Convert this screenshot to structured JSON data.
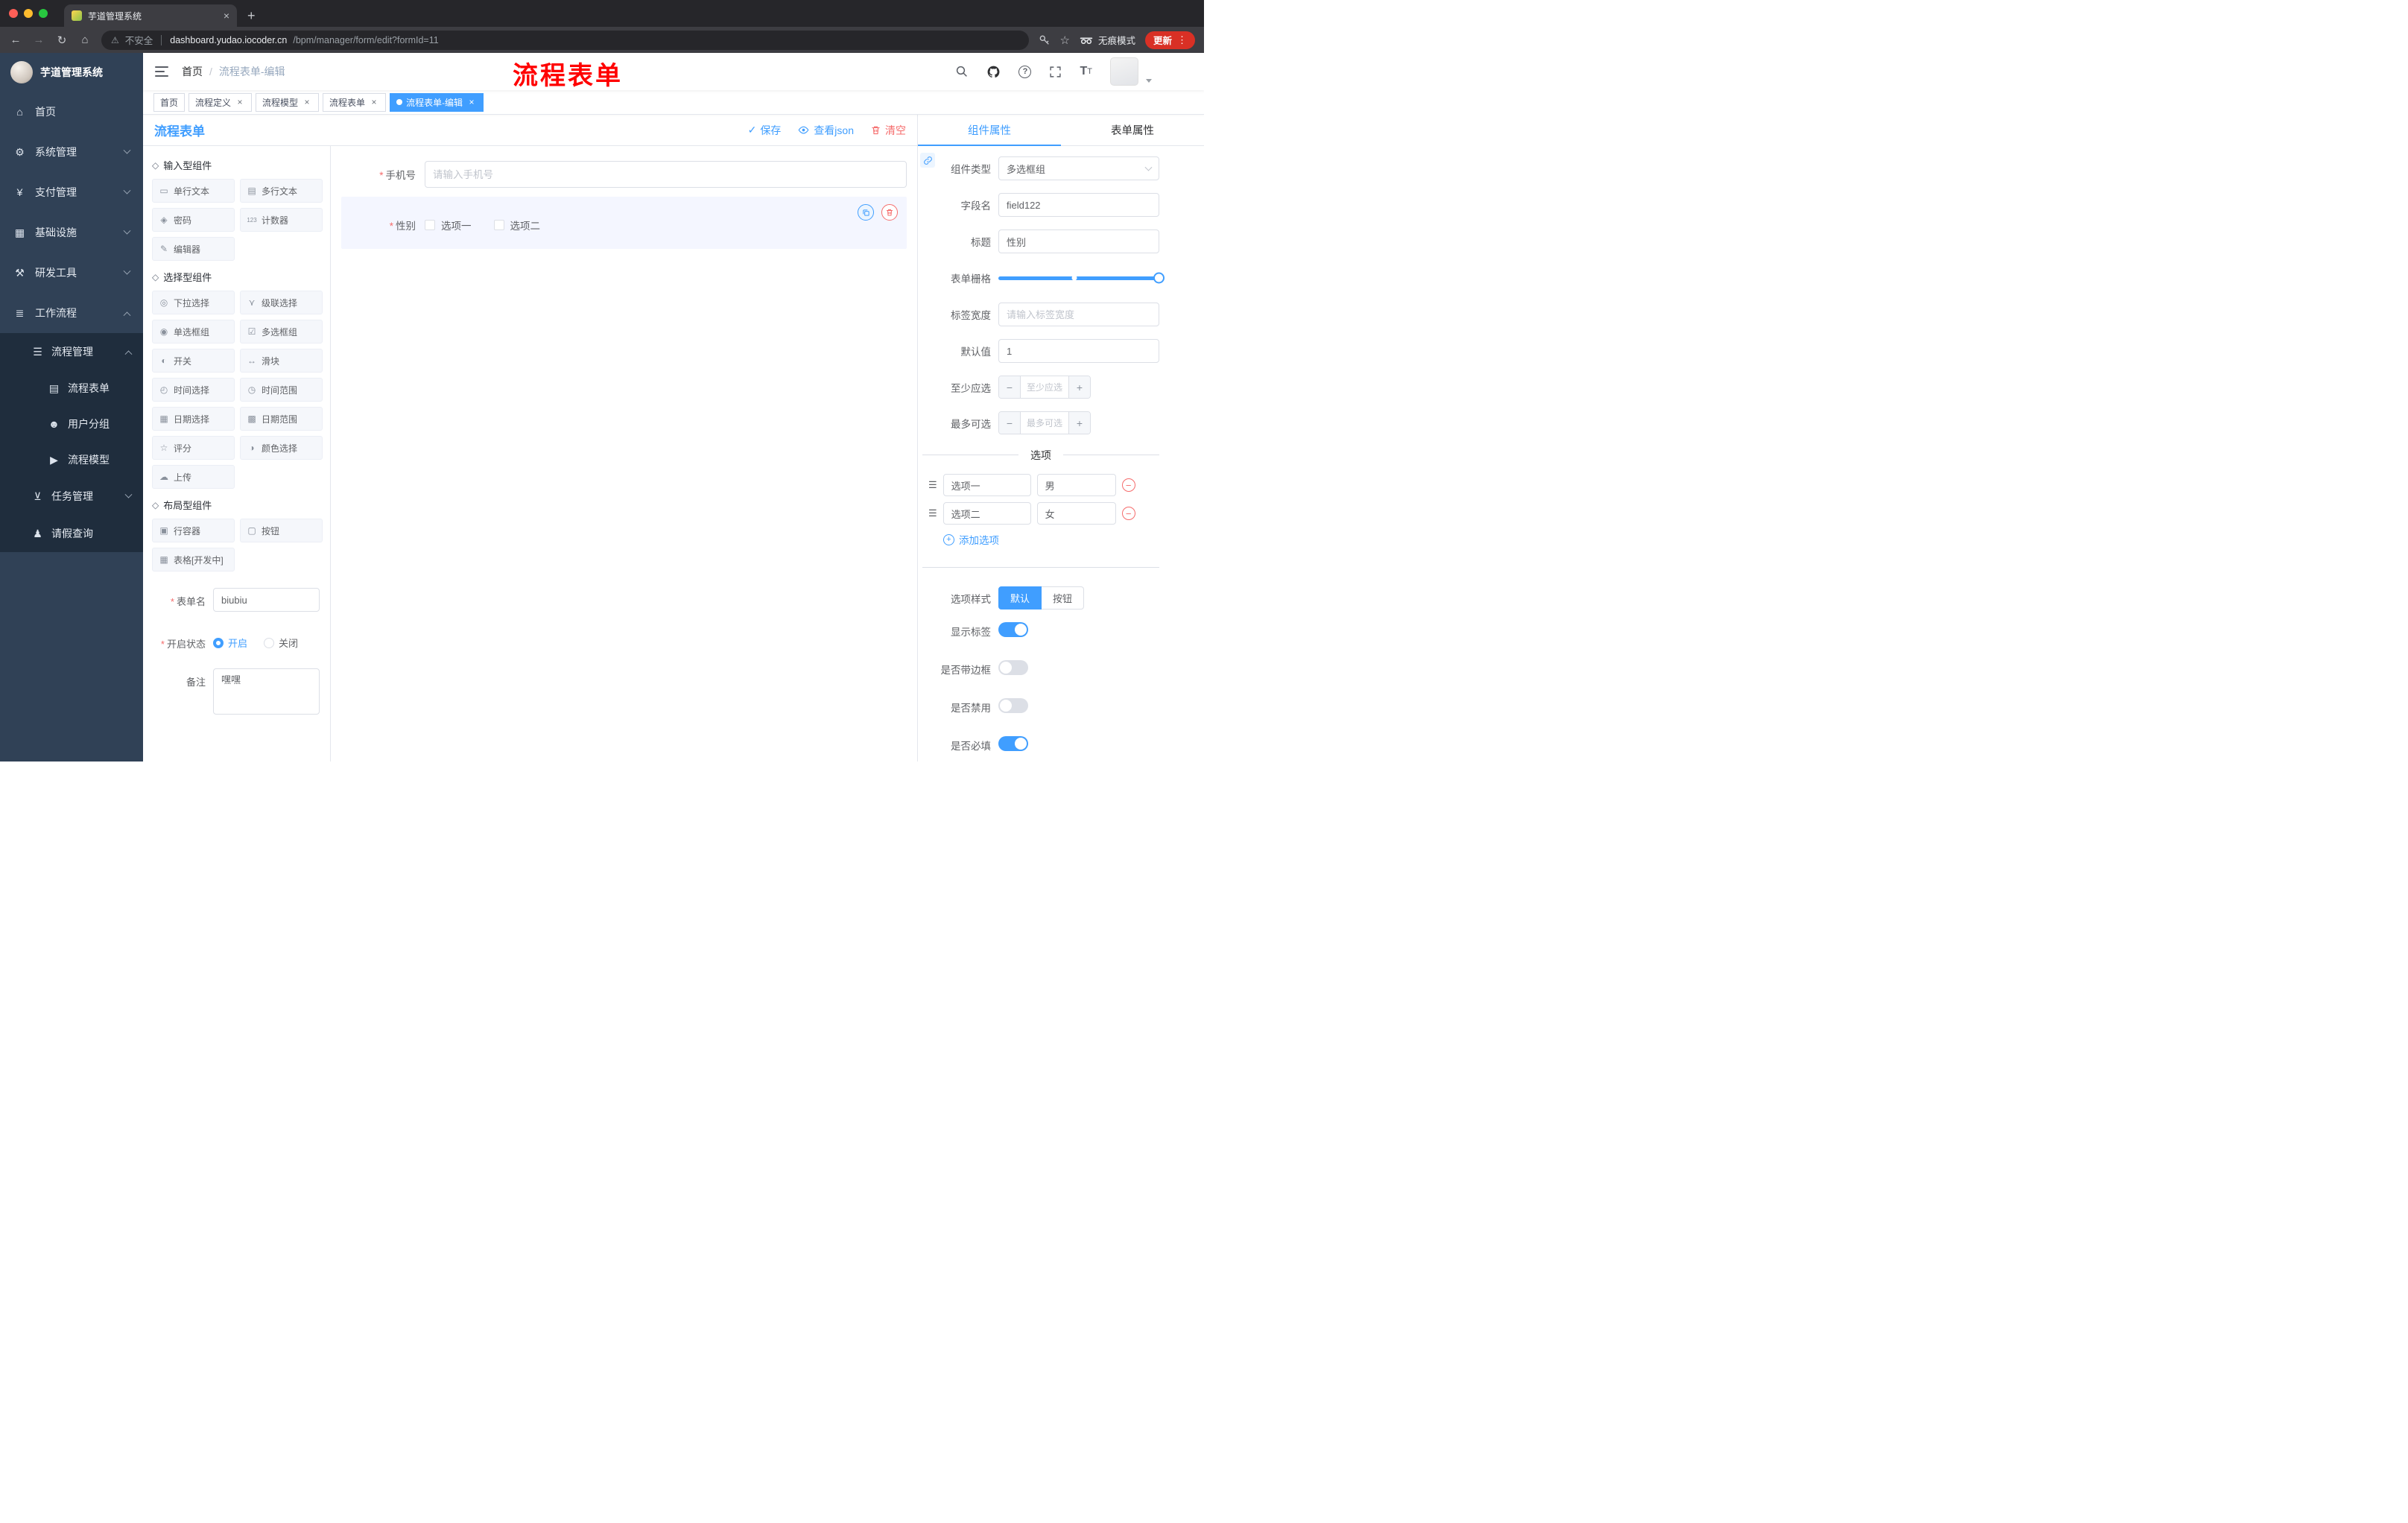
{
  "browser": {
    "tab_title": "芋道管理系统",
    "security_label": "不安全",
    "url_host": "dashboard.yudao.iocoder.cn",
    "url_path": "/bpm/manager/form/edit?formId=11",
    "incognito_label": "无痕模式",
    "update_label": "更新"
  },
  "sidebar": {
    "logo_title": "芋道管理系统",
    "home": "首页",
    "system": "系统管理",
    "payment": "支付管理",
    "infra": "基础设施",
    "devtools": "研发工具",
    "workflow": "工作流程",
    "process_mgmt": "流程管理",
    "process_form": "流程表单",
    "user_group": "用户分组",
    "process_model": "流程模型",
    "task_mgmt": "任务管理",
    "leave_query": "请假查询"
  },
  "header": {
    "breadcrumb_home": "首页",
    "breadcrumb_current": "流程表单-编辑",
    "annotation": "流程表单"
  },
  "tags": [
    {
      "label": "首页"
    },
    {
      "label": "流程定义"
    },
    {
      "label": "流程模型"
    },
    {
      "label": "流程表单"
    },
    {
      "label": "流程表单-编辑"
    }
  ],
  "workspace": {
    "title": "流程表单",
    "save_label": "保存",
    "view_json_label": "查看json",
    "clear_label": "清空"
  },
  "palette": {
    "sections": [
      {
        "title": "输入型组件",
        "items": [
          "单行文本",
          "多行文本",
          "密码",
          "计数器",
          "编辑器"
        ]
      },
      {
        "title": "选择型组件",
        "items": [
          "下拉选择",
          "级联选择",
          "单选框组",
          "多选框组",
          "开关",
          "滑块",
          "时间选择",
          "时间范围",
          "日期选择",
          "日期范围",
          "评分",
          "颜色选择",
          "上传"
        ]
      },
      {
        "title": "布局型组件",
        "items": [
          "行容器",
          "按钮",
          "表格[开发中]"
        ]
      }
    ]
  },
  "form_config": {
    "name_label": "表单名",
    "name_value": "biubiu",
    "status_label": "开启状态",
    "status_on": "开启",
    "status_off": "关闭",
    "remark_label": "备注",
    "remark_value": "嘿嘿"
  },
  "canvas": {
    "phone_label": "手机号",
    "phone_placeholder": "请输入手机号",
    "gender_label": "性别",
    "gender_option1": "选项一",
    "gender_option2": "选项二"
  },
  "props": {
    "tab_component": "组件属性",
    "tab_form": "表单属性",
    "type_label": "组件类型",
    "type_value": "多选框组",
    "field_label": "字段名",
    "field_value": "field122",
    "title_label": "标题",
    "title_value": "性别",
    "grid_label": "表单栅格",
    "width_label": "标签宽度",
    "width_placeholder": "请输入标签宽度",
    "default_label": "默认值",
    "default_value": "1",
    "min_label": "至少应选",
    "min_placeholder": "至少应选",
    "max_label": "最多可选",
    "max_placeholder": "最多可选",
    "options_divider": "选项",
    "options": [
      {
        "name": "选项一",
        "value": "男"
      },
      {
        "name": "选项二",
        "value": "女"
      }
    ],
    "add_option": "添加选项",
    "style_label": "选项样式",
    "style_default": "默认",
    "style_button": "按钮",
    "switch_show_label": "显示标签",
    "switch_border": "是否带边框",
    "switch_disabled": "是否禁用",
    "switch_required": "是否必填"
  },
  "colors": {
    "accent": "#409eff",
    "danger": "#f56c6c",
    "annotation_red": "#ff0000",
    "sidebar_bg": "#304156",
    "submenu_bg": "#1f2d3d"
  },
  "icons": {
    "palette_section": "◇",
    "single_line_text": "▭",
    "multi_line_text": "▤",
    "password": "◈",
    "counter": "123",
    "editor": "✎",
    "dropdown": "◎",
    "cascader": "⋎",
    "radio_group": "◉",
    "checkbox_group": "☑",
    "switch": "◐",
    "slider": "↔",
    "time_picker": "◴",
    "time_range": "◷",
    "date_picker": "▦",
    "date_range": "▩",
    "rate": "☆",
    "color_picker": "◑",
    "upload": "☁",
    "row_container": "▣",
    "button": "▢",
    "table": "▦",
    "menu_home": "⌂",
    "menu_system": "⚙",
    "menu_payment": "¥",
    "menu_infra": "▦",
    "menu_devtools": "⚒",
    "menu_workflow": "≣",
    "menu_process": "☰",
    "menu_form": "▤",
    "menu_users": "☻",
    "menu_model": "▶",
    "menu_task": "⊻",
    "menu_person": "♟",
    "drag_handle": "☰",
    "save_check": "✓",
    "close": "×",
    "kebab": "⋮",
    "back": "←",
    "forward": "→",
    "reload": "↻",
    "home_nav": "⌂",
    "star": "☆",
    "new_tab": "+",
    "warning": "⚠",
    "help": "?",
    "font_size": "T",
    "minus": "−",
    "plus": "+"
  }
}
